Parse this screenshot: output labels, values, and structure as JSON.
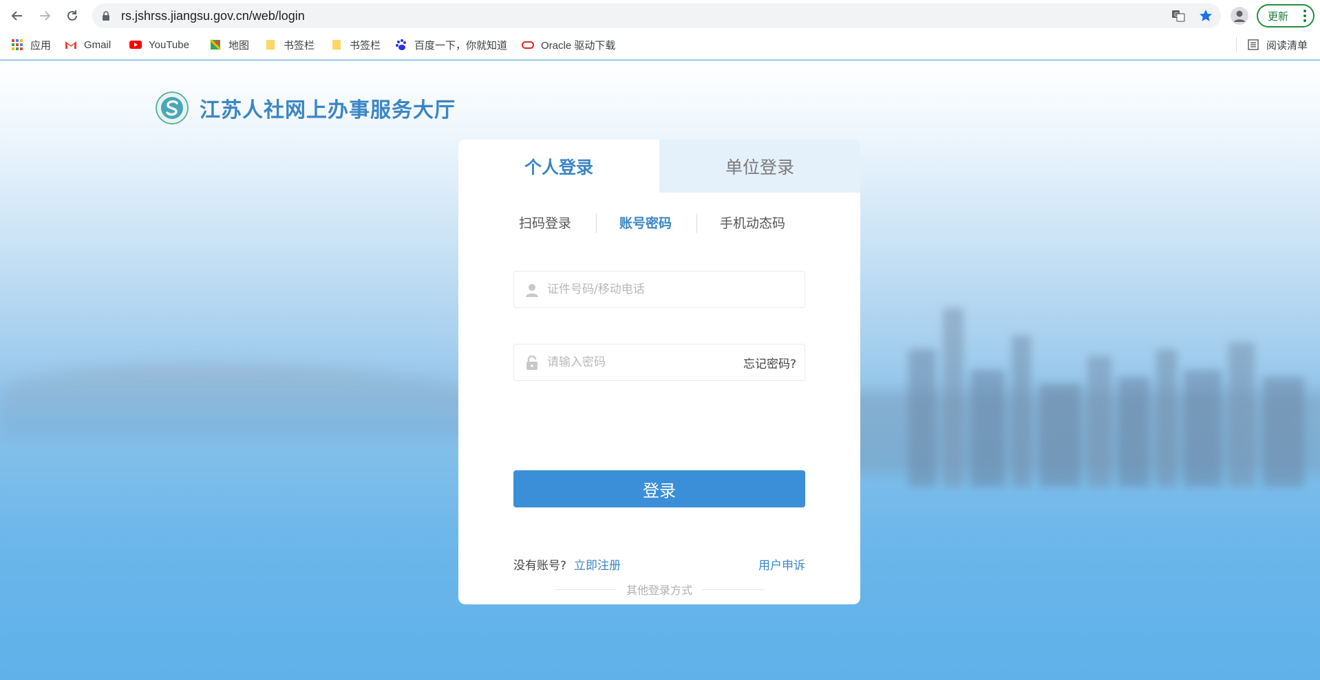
{
  "browser": {
    "url": "rs.jshrss.jiangsu.gov.cn/web/login",
    "update_label": "更新",
    "bookmarks": [
      "应用",
      "Gmail",
      "YouTube",
      "地图",
      "书签栏",
      "书签栏",
      "百度一下，你就知道",
      "Oracle 驱动下载"
    ],
    "reading_list": "阅读清单"
  },
  "site": {
    "title": "江苏人社网上办事服务大厅"
  },
  "login": {
    "tabs": [
      "个人登录",
      "单位登录"
    ],
    "active_tab": "个人登录",
    "subtabs": [
      "扫码登录",
      "账号密码",
      "手机动态码"
    ],
    "active_subtab": "账号密码",
    "id_placeholder": "证件号码/移动电话",
    "password_placeholder": "请输入密码",
    "forgot": "忘记密码?",
    "submit": "登录",
    "no_account": "没有账号?",
    "register": "立即注册",
    "complain": "用户申诉",
    "other_methods": "其他登录方式"
  },
  "colors": {
    "brand": "#3b86c4",
    "button": "#3b8fd9",
    "update_green": "#188038"
  },
  "icons": {
    "alt_login": [
      "red-app-icon",
      "su-service-icon",
      "alipay-icon"
    ]
  }
}
